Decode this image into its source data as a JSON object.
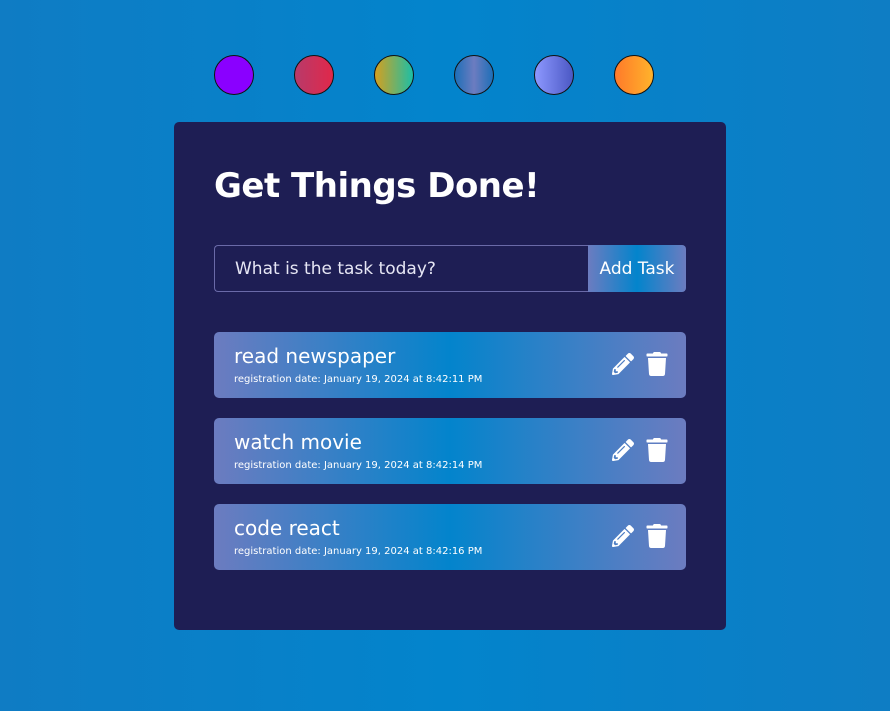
{
  "theme": {
    "swatches": [
      {
        "name": "violet",
        "bg": "linear-gradient(90deg,#8a00ff,#8a00ff)"
      },
      {
        "name": "crimson",
        "bg": "linear-gradient(90deg,#b83a6a,#e0284a)"
      },
      {
        "name": "gold-teal",
        "bg": "linear-gradient(90deg,#d4a020,#1cbfa6)"
      },
      {
        "name": "ocean",
        "bg": "linear-gradient(90deg,#1d6fb8,#6c7cc0,#1d6fb8)"
      },
      {
        "name": "periwinkle",
        "bg": "linear-gradient(90deg,#8d98ff,#4b58c4)"
      },
      {
        "name": "sunset",
        "bg": "linear-gradient(90deg,#ff7a2a,#ffb32b)"
      }
    ]
  },
  "app": {
    "title": "Get Things Done!",
    "input_placeholder": "What is the task today?",
    "add_button": "Add Task"
  },
  "tasks": [
    {
      "name": "read newspaper",
      "date": "registration date: January 19, 2024 at 8:42:11 PM"
    },
    {
      "name": "watch movie",
      "date": "registration date: January 19, 2024 at 8:42:14 PM"
    },
    {
      "name": "code react",
      "date": "registration date: January 19, 2024 at 8:42:16 PM"
    }
  ],
  "icons": {
    "edit": "pencil-icon",
    "delete": "trash-icon"
  }
}
